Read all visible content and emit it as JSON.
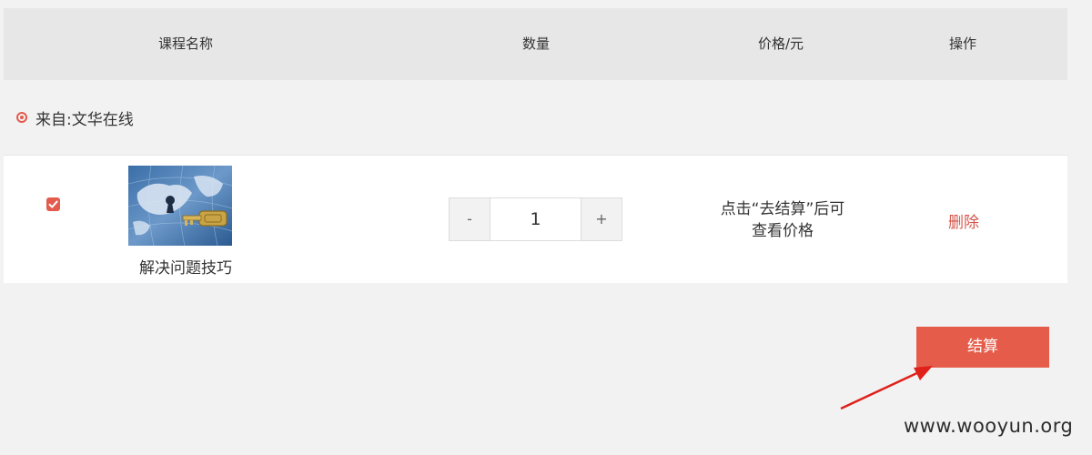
{
  "header": {
    "course_name": "课程名称",
    "quantity": "数量",
    "price": "价格/元",
    "action": "操作"
  },
  "source": {
    "label": "来自:文华在线"
  },
  "cart_item": {
    "checked": true,
    "course_name": "解决问题技巧",
    "quantity": "1",
    "minus_label": "-",
    "plus_label": "+",
    "price_note_line1": "点击“去结算”后可",
    "price_note_line2": "查看价格",
    "delete_label": "删除"
  },
  "checkout": {
    "label": "结算"
  },
  "watermark": "www.wooyun.org",
  "colors": {
    "accent": "#e55c4a",
    "delete_text": "#d5564c",
    "annotation_arrow": "#e0201b"
  }
}
